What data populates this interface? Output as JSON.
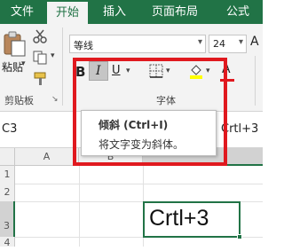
{
  "tabs": [
    "文件",
    "开始",
    "插入",
    "页面布局",
    "公式"
  ],
  "active_tab": "开始",
  "clipboard": {
    "paste_label": "粘贴",
    "group_label": "剪贴板"
  },
  "font": {
    "name": "等线",
    "size": "24",
    "italic_glyph": "I",
    "underline_glyph": "U",
    "font_color_glyph": "A",
    "group_label": "字体"
  },
  "name_box": "C3",
  "formula_text": "Crtl+3",
  "columns": [
    "A",
    "B"
  ],
  "rows": [
    "1",
    "2",
    "3",
    "4"
  ],
  "active_cell": {
    "ref": "C3",
    "value": "Crtl+3"
  },
  "tooltip": {
    "title": "倾斜 (Ctrl+I)",
    "description": "将文字变为斜体。"
  },
  "colors": {
    "accent": "#217346",
    "highlight_border": "#e0191f",
    "fill_yellow": "#ffff00",
    "font_red": "#e0191f"
  }
}
